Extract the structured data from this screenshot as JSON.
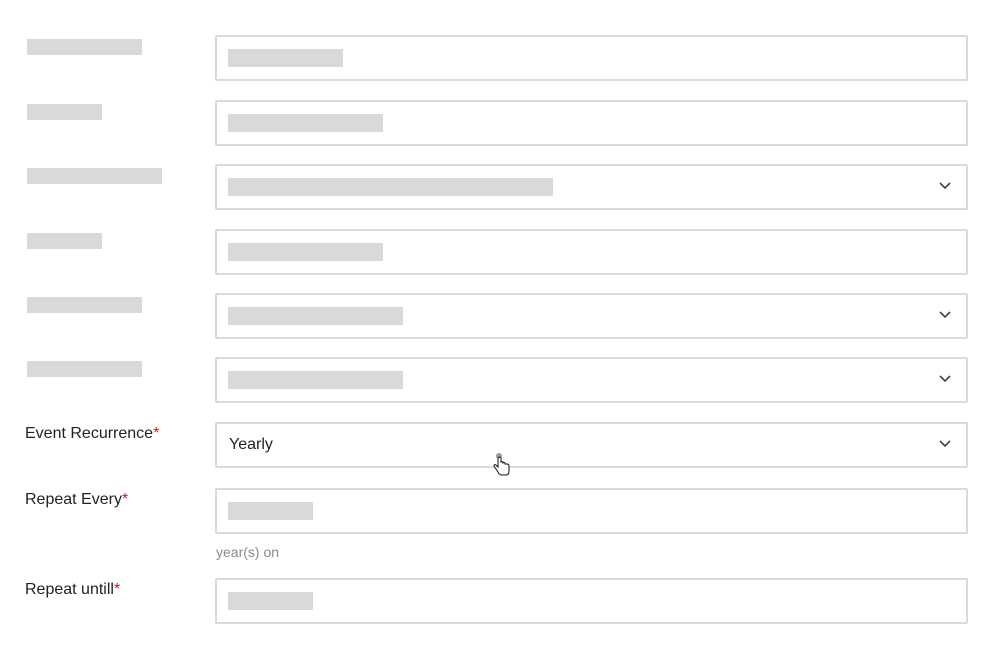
{
  "form": {
    "event_recurrence": {
      "label": "Event Recurrence",
      "required_mark": "*",
      "value": "Yearly"
    },
    "repeat_every": {
      "label": "Repeat Every",
      "required_mark": "*",
      "hint": "year(s) on"
    },
    "repeat_until": {
      "label": "Repeat untill",
      "required_mark": "*"
    }
  },
  "icons": {
    "dropdown": "chevron-down-icon",
    "cursor": "hand-pointer-cursor-icon"
  },
  "colors": {
    "required": "#e01010",
    "border": "#dadada",
    "skeleton": "#d9d9d9",
    "hint": "#8a8a8a"
  }
}
